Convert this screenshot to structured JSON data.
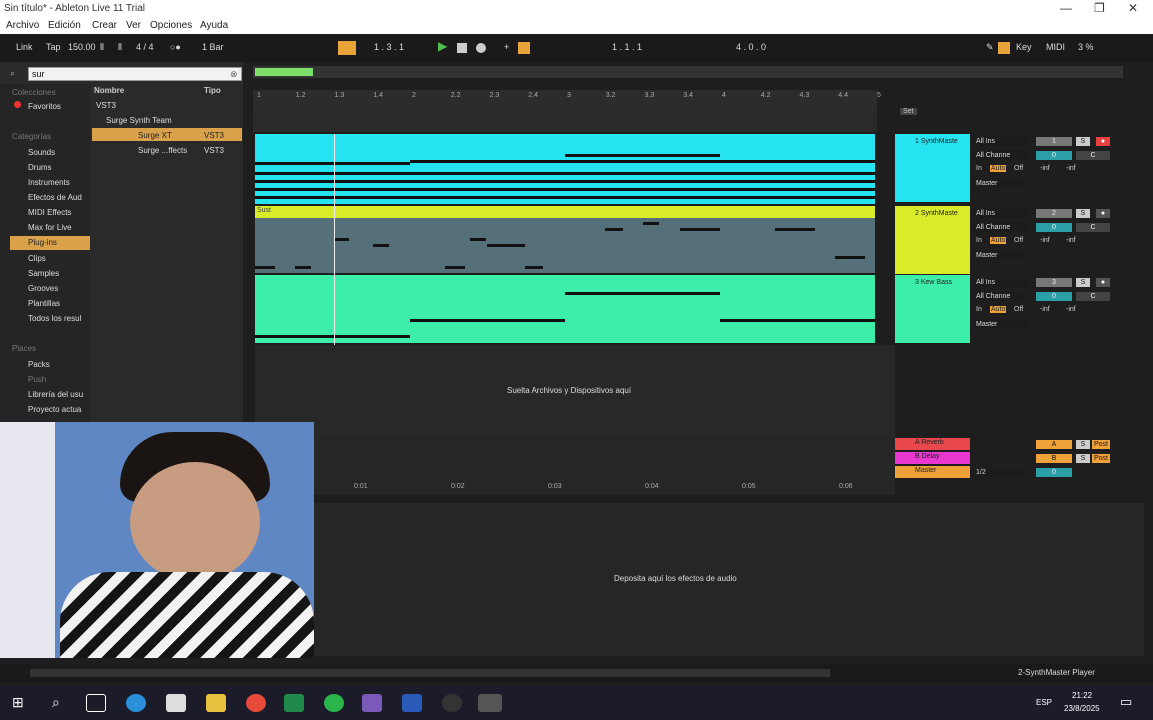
{
  "window": {
    "title": "Sin título* - Ableton Live 11 Trial"
  },
  "menu": [
    "Archivo",
    "Edición",
    "Crear",
    "Ver",
    "Opciones",
    "Ayuda"
  ],
  "transport": {
    "link": "Link",
    "tap": "Tap",
    "tempo": "150.00",
    "sig": "4 / 4",
    "quant": "1 Bar",
    "position": "1 . 3 . 1",
    "loop_start": "1 . 1 . 1",
    "loop_len": "4 . 0 . 0",
    "key": "Key",
    "midi": "MIDI",
    "cpu": "3 %"
  },
  "browser": {
    "search": "sur",
    "collections_header": "Colecciones",
    "favorites": "Favoritos",
    "categories_header": "Categorías",
    "categories": [
      "Sounds",
      "Drums",
      "Instruments",
      "Efectos de Aud",
      "MIDI Effects",
      "Max for Live",
      "Plug-ins",
      "Clips",
      "Samples",
      "Grooves",
      "Plantillas",
      "Todos los resul"
    ],
    "places_header": "Places",
    "places": [
      "Packs",
      "Push",
      "Librería del usu",
      "Proyecto actua"
    ],
    "col_name": "Nombre",
    "col_type": "Tipo",
    "tree": [
      {
        "name": "VST3",
        "type": ""
      },
      {
        "name": "Surge Synth Team",
        "type": ""
      },
      {
        "name": "Surge XT",
        "type": "VST3"
      },
      {
        "name": "Surge ...ffects",
        "type": "VST3"
      }
    ]
  },
  "ruler": [
    "1",
    "1.2",
    "1.3",
    "1.4",
    "2",
    "2.2",
    "2.3",
    "2.4",
    "3",
    "3.2",
    "3.3",
    "3.4",
    "4",
    "4.2",
    "4.3",
    "4.4",
    "5"
  ],
  "time_ruler": [
    "0:01",
    "0:02",
    "0:03",
    "0:04",
    "0:05",
    "0:06"
  ],
  "tracks": [
    {
      "name": "1 SynthMaste",
      "input": "All Ins",
      "channel": "All Channe",
      "monitor": [
        "In",
        "Auto",
        "Off"
      ],
      "output": "Master",
      "num": "1",
      "vol": "0",
      "pan": "C",
      "inf1": "-inf",
      "inf2": "-inf"
    },
    {
      "name": "2 SynthMaste",
      "input": "All Ins",
      "channel": "All Channe",
      "monitor": [
        "In",
        "Auto",
        "Off"
      ],
      "output": "Master",
      "num": "2",
      "vol": "0",
      "pan": "C",
      "inf1": "-inf",
      "inf2": "-inf",
      "clip": "Sust"
    },
    {
      "name": "3 Kew Bass",
      "input": "All Ins",
      "channel": "All Channe",
      "monitor": [
        "In",
        "Auto",
        "Off"
      ],
      "output": "Master",
      "num": "3",
      "vol": "0",
      "pan": "C",
      "inf1": "-inf",
      "inf2": "-inf"
    }
  ],
  "drop_files": "Suelta Archivos y Dispositivos aquí",
  "returns": [
    {
      "name": "A Reverb",
      "btn": "A",
      "s": "S",
      "post": "Post"
    },
    {
      "name": "B Delay",
      "btn": "B",
      "s": "S",
      "post": "Post"
    },
    {
      "name": "Master",
      "btn": "0",
      "s": "",
      "post": ""
    }
  ],
  "master_out": "1/2",
  "set_label": "Set",
  "drop_effects": "Deposita aquí los efectos de audio",
  "status_right": "2-SynthMaster Player",
  "taskbar": {
    "lang": "ESP",
    "time": "21:22",
    "date": "23/8/2025"
  }
}
